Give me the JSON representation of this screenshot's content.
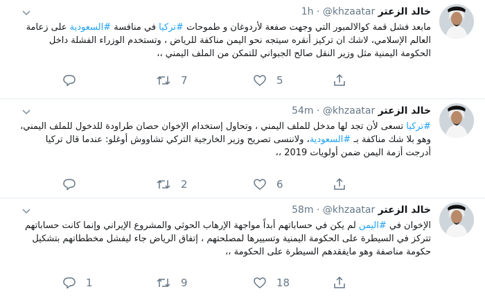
{
  "tweets": [
    {
      "name": "خالد الزعتر",
      "handle": "@khzaatar",
      "dot": "·",
      "time": "1h",
      "segments": [
        {
          "t": "مابعد فشل قمة كوالالمبور التي وجهت صفعة لأردوغان و طموحات ",
          "tag": false
        },
        {
          "t": "#تركيا",
          "tag": true
        },
        {
          "t": " في منافسة ",
          "tag": false
        },
        {
          "t": "#السعودية",
          "tag": true
        },
        {
          "t": " على زعامة العالم الإسلامي، لاشك ان تركيز أنقره سيتجه نحو اليمن مناكفة للرياض ، وتستخدم الوزراء الفشلة داخل الحكومة اليمنية مثل وزير النقل صالح الجبواني للتمكن من الملف اليمني ،،",
          "tag": false
        }
      ],
      "replies": "",
      "retweets": "7",
      "likes": "5"
    },
    {
      "name": "خالد الزعتر",
      "handle": "@khzaatar",
      "dot": "·",
      "time": "54m",
      "segments": [
        {
          "t": "#تركيا",
          "tag": true
        },
        {
          "t": " تسعى لأن تجد لها مدخل للملف اليمني ، وتحاول إستخدام الإخوان حصان طراودة للدخول للملف اليمني، وهو بلا شك مناكفة بـ ",
          "tag": false
        },
        {
          "t": "#السعودية",
          "tag": true
        },
        {
          "t": "، ولاننسى تصريح وزير الخارجية التركي تشاووش أوغلو: عندما قال تركيا أدرجت أزمة اليمن ضمن أولويات 2019 ،،",
          "tag": false
        }
      ],
      "replies": "",
      "retweets": "2",
      "likes": "6"
    },
    {
      "name": "خالد الزعتر",
      "handle": "@khzaatar",
      "dot": "·",
      "time": "58m",
      "segments": [
        {
          "t": "الإخوان في ",
          "tag": false
        },
        {
          "t": "#اليمن",
          "tag": true
        },
        {
          "t": " لم يكن في حساباتهم أبداً مواجهة الإرهاب الحوثي والمشروع الإيراني وإنما كانت حساباتهم تتركز في السيطرة على الحكومة اليمنية وتسييرها لمصلحتهم ، إتفاق الرياض جاء ليفشل مخططاتهم بتشكيل حكومة مناصفة وهو مايفقدهم السيطرة على الحكومة ،،",
          "tag": false
        }
      ],
      "replies": "1",
      "retweets": "9",
      "likes": "18"
    }
  ]
}
